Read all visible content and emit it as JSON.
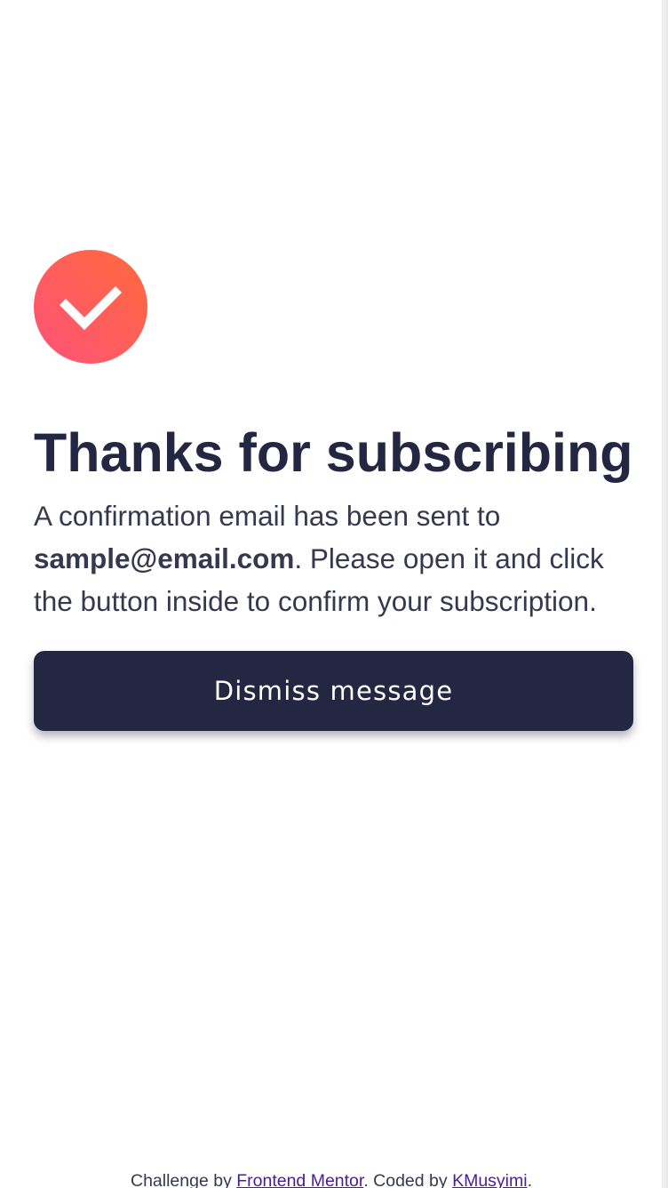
{
  "card": {
    "title": "Thanks for subscribing",
    "message_prefix": "A confirmation email has been sent to ",
    "email": "sample@email.com",
    "message_suffix": ". Please open it and click the button inside to confirm your subscription.",
    "button_label": "Dismiss message",
    "icon": "check-icon"
  },
  "attribution": {
    "prefix": "Challenge by ",
    "challenge_link": "Frontend Mentor",
    "middle": ". Coded by ",
    "author_link": "KMusyimi",
    "suffix": "."
  },
  "colors": {
    "dark_navy": "#242742",
    "charcoal": "#36384d",
    "tomato_start": "#ff6a3a",
    "tomato_end": "#ff527b",
    "link": "#4b1d93"
  }
}
